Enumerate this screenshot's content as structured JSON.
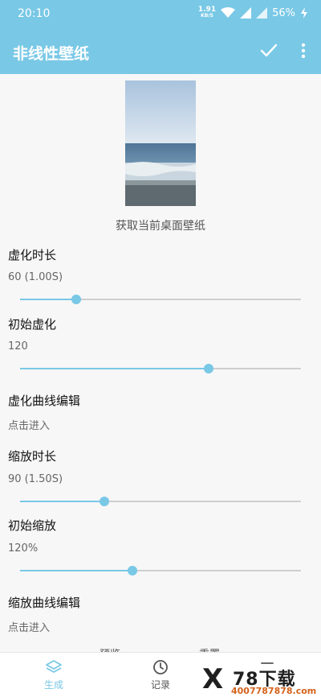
{
  "status_bar": {
    "time": "20:10",
    "net_speed": "1.91",
    "net_unit": "KB/S",
    "battery": "56%"
  },
  "app_bar": {
    "title": "非线性壁纸",
    "icons": [
      "check-icon",
      "more-vert-icon"
    ]
  },
  "wallpaper": {
    "caption": "获取当前桌面壁纸"
  },
  "settings": [
    {
      "title": "虚化时长",
      "value": "60 (1.00S)",
      "slider": 0.2
    },
    {
      "title": "初始虚化",
      "value": "120",
      "slider": 0.67
    },
    {
      "title": "虚化曲线编辑",
      "value": "点击进入"
    },
    {
      "title": "缩放时长",
      "value": "90 (1.50S)",
      "slider": 0.3
    },
    {
      "title": "初始缩放",
      "value": "120%",
      "slider": 0.4
    },
    {
      "title": "缩放曲线编辑",
      "value": "点击进入"
    }
  ],
  "floating": {
    "preview": "预览",
    "reset": "重置"
  },
  "bottom_nav": [
    {
      "label": "生成",
      "icon": "layers-icon",
      "active": true
    },
    {
      "label": "记录",
      "icon": "clock-icon",
      "active": false
    },
    {
      "label": "",
      "icon": "menu-icon",
      "active": false
    }
  ],
  "watermark": {
    "logo": "X",
    "big": "78下载",
    "small": "4007787878.com"
  },
  "colors": {
    "accent": "#79c8e6",
    "track": "#cfcfcf"
  }
}
